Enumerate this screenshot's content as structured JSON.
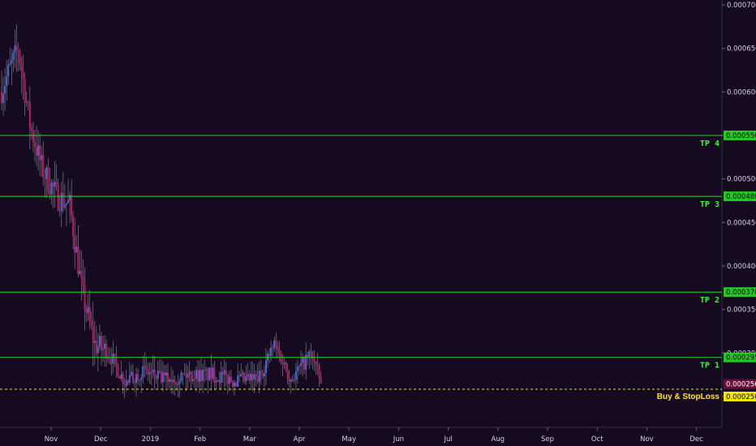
{
  "chart_data": {
    "type": "candlestick",
    "title": "",
    "xlabel": "",
    "ylabel": "",
    "ylim": [
      0.00022,
      0.0007
    ],
    "y_ticks": [
      "0.000700",
      "0.000650",
      "0.000600",
      "0.000550",
      "0.000500",
      "0.000450",
      "0.000400",
      "0.000350",
      "0.000300",
      "0.000250"
    ],
    "x_ticks": [
      "Nov",
      "Dec",
      "2019",
      "Feb",
      "Mar",
      "Apr",
      "May",
      "Jun",
      "Jul",
      "Aug",
      "Sep",
      "Oct",
      "Nov",
      "Dec"
    ],
    "price_path": [
      [
        "Oct",
        0.0006
      ],
      [
        "Oct",
        0.00065
      ],
      [
        "Oct",
        0.00056
      ],
      [
        "Oct",
        0.00051
      ],
      [
        "Nov",
        0.00048
      ],
      [
        "Nov",
        0.00047
      ],
      [
        "Nov",
        0.00037
      ],
      [
        "Nov",
        0.00031
      ],
      [
        "Dec",
        0.0003
      ],
      [
        "Dec",
        0.000265
      ],
      [
        "Dec",
        0.00028
      ],
      [
        "2019",
        0.00027
      ],
      [
        "2019",
        0.000275
      ],
      [
        "Feb",
        0.000275
      ],
      [
        "Feb",
        0.000268
      ],
      [
        "Mar",
        0.00027
      ],
      [
        "Mar",
        0.00031
      ],
      [
        "Mar",
        0.00027
      ],
      [
        "Apr",
        0.0003
      ],
      [
        "Apr",
        0.000256
      ]
    ],
    "levels": [
      {
        "label": "TP 4",
        "value": "0.000550",
        "color": "#2ad82a"
      },
      {
        "label": "TP 3",
        "value": "0.000480",
        "color": "#2ad82a"
      },
      {
        "label": "TP 2",
        "value": "0.000370",
        "color": "#2ad82a"
      },
      {
        "label": "TP 1",
        "value": "0.000295",
        "color": "#2ad82a"
      },
      {
        "label": "Buy & StopLoss",
        "value": "0.000250",
        "color": "#f5e600",
        "dashed": true
      }
    ],
    "last_price": {
      "value": "0.000256",
      "color": "#6b0f3a"
    },
    "colors": {
      "background": "#150a1f",
      "up": "#3a6fd8",
      "down": "#c2185b",
      "wick": "#b8b8c8"
    }
  }
}
